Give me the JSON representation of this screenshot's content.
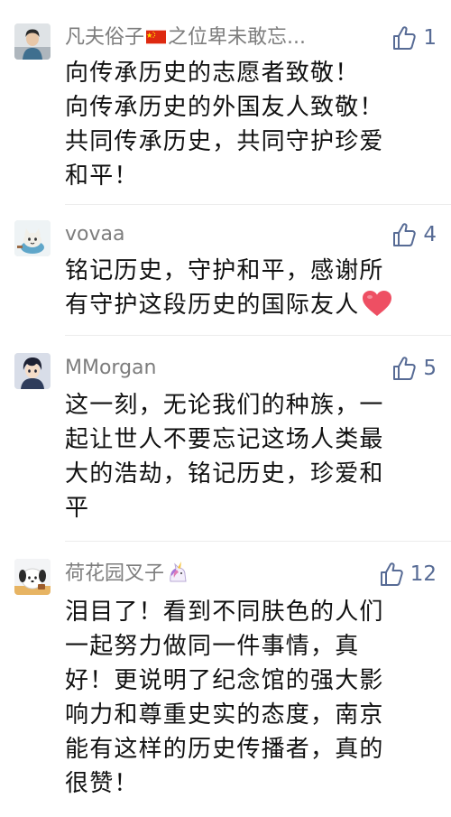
{
  "colors": {
    "username": "#7d7d7d",
    "like": "#576b95",
    "text": "#111111",
    "divider": "#ececec"
  },
  "comments": [
    {
      "author_prefix": "凡夫俗子",
      "author_flag_icon": "china-flag-icon",
      "author_suffix": "之位卑未敢忘...",
      "likes": "1",
      "avatar_icon": "avatar-man-icon",
      "lines": [
        "向传承历史的志愿者致敬！",
        "向传承历史的外国友人致敬！",
        "共同传承历史，共同守护珍爱",
        "和平！"
      ]
    },
    {
      "author": "vovaa",
      "likes": "4",
      "avatar_icon": "avatar-cat-icon",
      "lines": [
        "铭记历史，守护和平，感谢所",
        "有守护这段历史的国际友人"
      ],
      "trailing_icon": "heart-icon"
    },
    {
      "author": "MMorgan",
      "likes": "5",
      "avatar_icon": "avatar-anime-icon",
      "lines": [
        "这一刻，无论我们的种族，一",
        "起让世人不要忘记这场人类最",
        "大的浩劫，铭记历史，珍爱和",
        "平"
      ]
    },
    {
      "author": "荷花园叉子",
      "author_trailing_icon": "unicorn-icon",
      "likes": "12",
      "avatar_icon": "avatar-pochacco-icon",
      "lines": [
        "泪目了！看到不同肤色的人们",
        "一起努力做同一件事情，真",
        "好！更说明了纪念馆的强大影",
        "响力和尊重史实的态度，南京",
        "能有这样的历史传播者，真的",
        "很赞！"
      ]
    }
  ]
}
